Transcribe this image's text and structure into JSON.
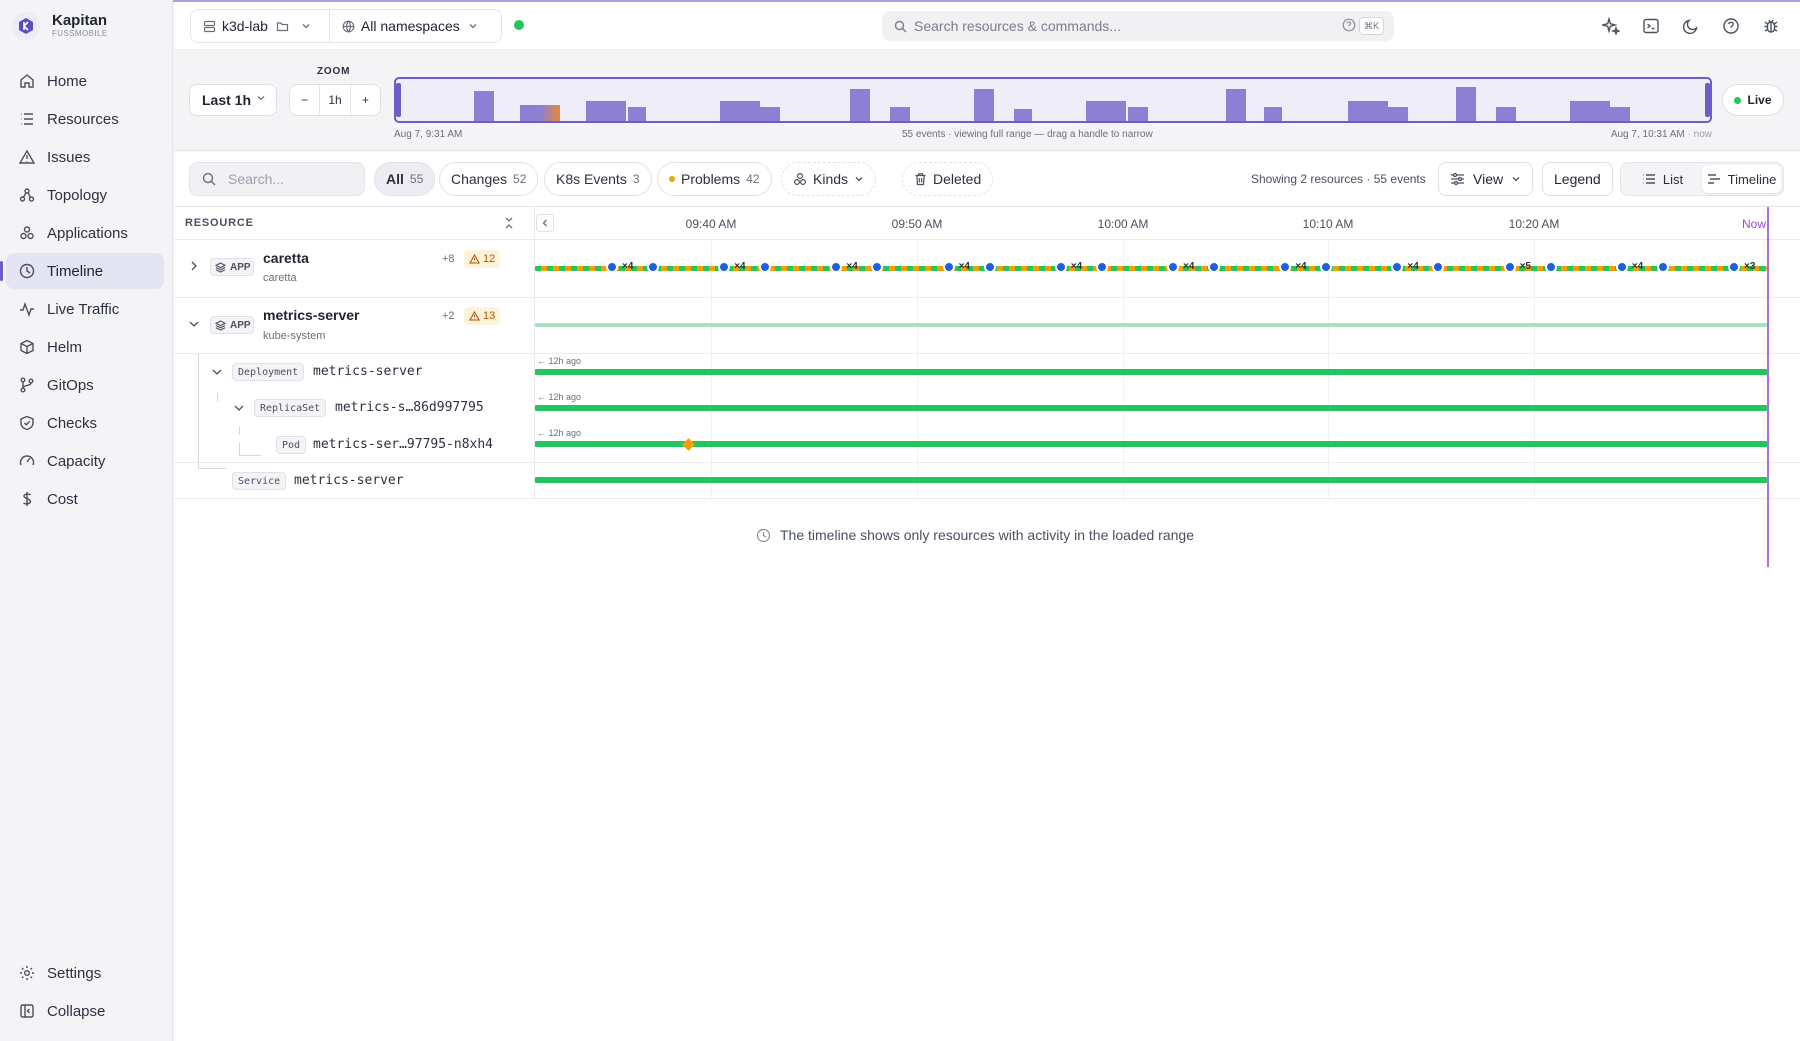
{
  "brand": {
    "name": "Kapitan",
    "sub": "FUSSMOBILE"
  },
  "nav": {
    "items": [
      {
        "label": "Home",
        "icon": "home-icon"
      },
      {
        "label": "Resources",
        "icon": "list-icon"
      },
      {
        "label": "Issues",
        "icon": "warning-icon"
      },
      {
        "label": "Topology",
        "icon": "topology-icon"
      },
      {
        "label": "Applications",
        "icon": "apps-icon"
      },
      {
        "label": "Timeline",
        "icon": "clock-icon",
        "active": true
      },
      {
        "label": "Live Traffic",
        "icon": "activity-icon"
      },
      {
        "label": "Helm",
        "icon": "package-icon"
      },
      {
        "label": "GitOps",
        "icon": "git-branch-icon"
      },
      {
        "label": "Checks",
        "icon": "shield-icon"
      },
      {
        "label": "Capacity",
        "icon": "gauge-icon"
      },
      {
        "label": "Cost",
        "icon": "dollar-icon"
      }
    ],
    "bottom": [
      {
        "label": "Settings",
        "icon": "gear-icon"
      },
      {
        "label": "Collapse",
        "icon": "sidebar-collapse-icon"
      }
    ]
  },
  "topbar": {
    "cluster": "k3d-lab",
    "namespace": "All namespaces",
    "search_placeholder": "Search resources & commands...",
    "shortcut": "⌘K",
    "status_color": "#22c55e"
  },
  "zoom": {
    "range": "Last 1h",
    "label": "ZOOM",
    "minus": "−",
    "value": "1h",
    "plus": "+",
    "live": "Live",
    "start": "Aug 7, 9:31 AM",
    "summary": "55 events · viewing full range — drag a handle to narrow",
    "end": "Aug 7, 10:31 AM",
    "end_suffix": " · now"
  },
  "filters": {
    "search_placeholder": "Search...",
    "chips": [
      {
        "label": "All",
        "count": "55"
      },
      {
        "label": "Changes",
        "count": "52"
      },
      {
        "label": "K8s Events",
        "count": "3"
      },
      {
        "label": "Problems",
        "count": "42"
      }
    ],
    "kinds": "Kinds",
    "deleted": "Deleted",
    "showing": "Showing 2 resources · 55 events",
    "view": "View",
    "legend": "Legend",
    "list": "List",
    "timeline": "Timeline"
  },
  "timeline": {
    "resource_header": "RESOURCE",
    "ticks": [
      "09:40 AM",
      "09:50 AM",
      "10:00 AM",
      "10:10 AM",
      "10:20 AM",
      "Now"
    ],
    "apps": [
      {
        "name": "caretta",
        "namespace": "caretta",
        "badge": "APP",
        "plus": "+8",
        "warnings": "12",
        "event_counts": [
          "×4",
          "×4",
          "×4",
          "×4",
          "×4",
          "×4",
          "×4",
          "×4",
          "×5",
          "×4",
          "×3"
        ]
      },
      {
        "name": "metrics-server",
        "namespace": "kube-system",
        "badge": "APP",
        "plus": "+2",
        "warnings": "13",
        "children": [
          {
            "kind": "Deployment",
            "name": "metrics-server",
            "ago": "← 12h ago"
          },
          {
            "kind": "ReplicaSet",
            "name": "metrics-s…86d997795",
            "ago": "← 12h ago"
          },
          {
            "kind": "Pod",
            "name": "metrics-ser…97795-n8xh4",
            "ago": "← 12h ago"
          },
          {
            "kind": "Service",
            "name": "metrics-server"
          }
        ]
      }
    ],
    "note": "The timeline shows only resources with activity in the loaded range"
  },
  "colors": {
    "accent": "#6b5fc7",
    "healthy": "#22c55e",
    "problem": "#f59e0b",
    "event": "#1d5fe0",
    "now": "#b06ee0"
  }
}
